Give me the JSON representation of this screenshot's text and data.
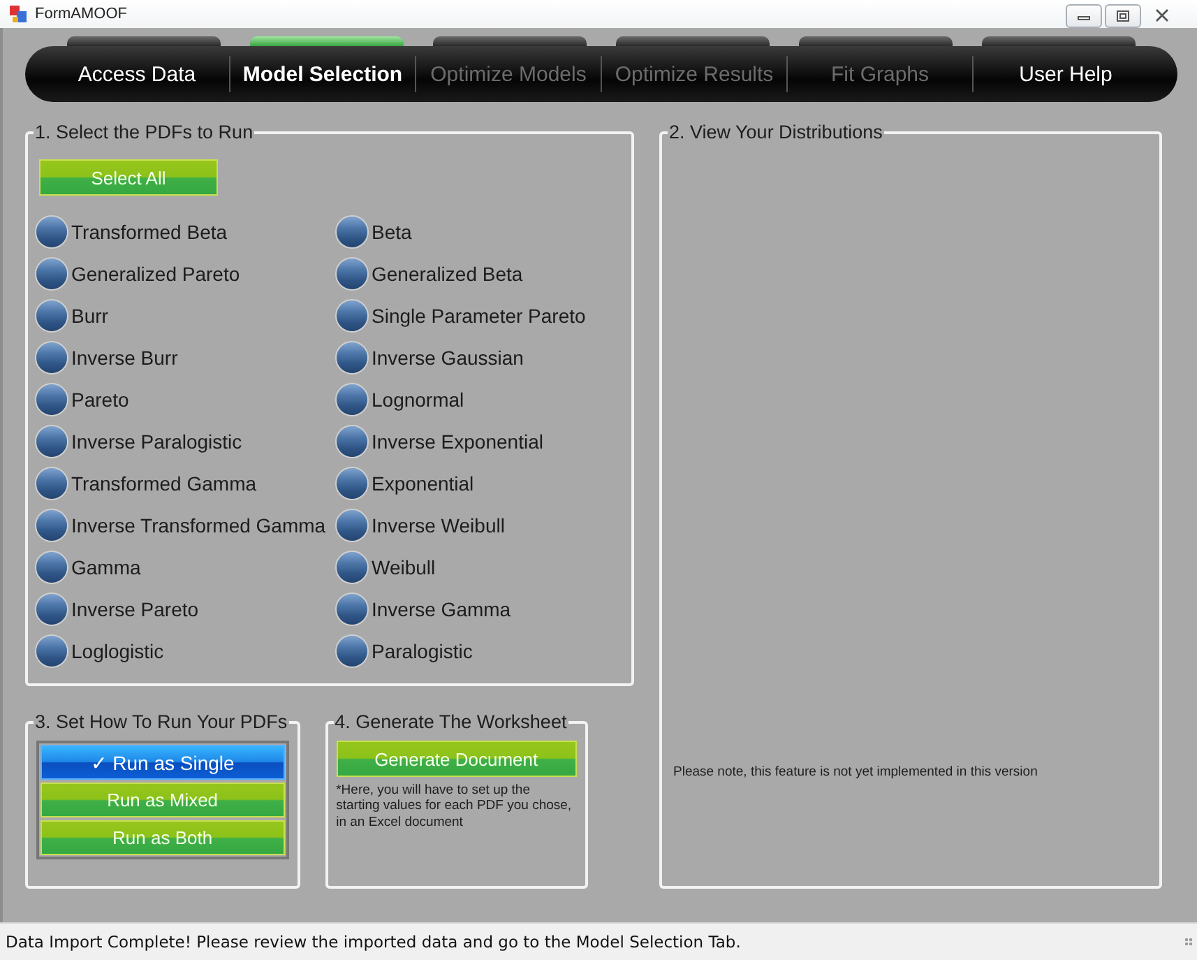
{
  "window": {
    "title": "FormAMOOF"
  },
  "tabs": [
    {
      "label": "Access Data",
      "selected": false,
      "disabled": false
    },
    {
      "label": "Model Selection",
      "selected": true,
      "disabled": false
    },
    {
      "label": "Optimize Models",
      "selected": false,
      "disabled": true
    },
    {
      "label": "Optimize Results",
      "selected": false,
      "disabled": true
    },
    {
      "label": "Fit Graphs",
      "selected": false,
      "disabled": true
    },
    {
      "label": "User Help",
      "selected": false,
      "disabled": false
    }
  ],
  "select_pdfs": {
    "title": "1. Select the PDFs to Run",
    "select_all": "Select All",
    "options": [
      {
        "label": "Transformed Beta",
        "selected": false
      },
      {
        "label": "Beta",
        "selected": false
      },
      {
        "label": "Generalized Pareto",
        "selected": false
      },
      {
        "label": "Generalized Beta",
        "selected": false
      },
      {
        "label": "Burr",
        "selected": false
      },
      {
        "label": "Single Parameter Pareto",
        "selected": false
      },
      {
        "label": "Inverse Burr",
        "selected": false
      },
      {
        "label": "Inverse Gaussian",
        "selected": false
      },
      {
        "label": "Pareto",
        "selected": false
      },
      {
        "label": "Lognormal",
        "selected": false
      },
      {
        "label": "Inverse Paralogistic",
        "selected": false
      },
      {
        "label": "Inverse Exponential",
        "selected": false
      },
      {
        "label": "Transformed Gamma",
        "selected": false
      },
      {
        "label": "Exponential",
        "selected": false
      },
      {
        "label": "Inverse Transformed Gamma",
        "selected": false
      },
      {
        "label": "Inverse Weibull",
        "selected": false
      },
      {
        "label": "Gamma",
        "selected": false
      },
      {
        "label": "Weibull",
        "selected": false
      },
      {
        "label": "Inverse Pareto",
        "selected": false
      },
      {
        "label": "Inverse Gamma",
        "selected": false
      },
      {
        "label": "Loglogistic",
        "selected": false
      },
      {
        "label": "Paralogistic",
        "selected": false
      }
    ]
  },
  "distributions": {
    "title": "2. View Your Distributions",
    "note": "Please note, this feature is not yet implemented in this version"
  },
  "run_mode": {
    "title": "3. Set How To Run Your PDFs",
    "selected_mark": "✓",
    "options": [
      {
        "label": "Run as Single",
        "selected": true
      },
      {
        "label": "Run as Mixed",
        "selected": false
      },
      {
        "label": "Run as Both",
        "selected": false
      }
    ]
  },
  "worksheet": {
    "title": "4. Generate The Worksheet",
    "button": "Generate Document",
    "note": "*Here, you will have to set up the starting values for each PDF you chose, in an Excel document"
  },
  "status_bar": "Data Import Complete! Please review the imported data and go to the Model Selection Tab."
}
